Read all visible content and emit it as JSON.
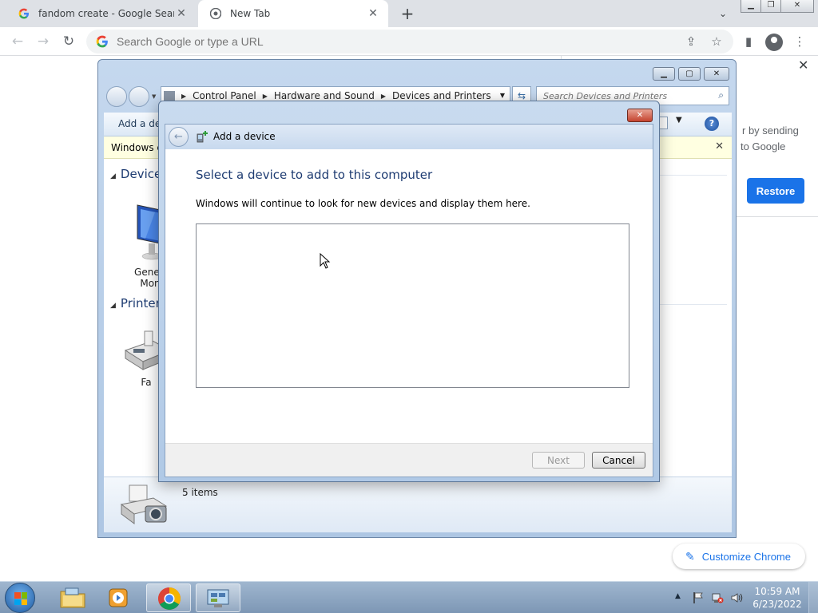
{
  "browser": {
    "tabs": [
      {
        "title": "fandom create - Google Search",
        "close": "✕"
      },
      {
        "title": "New Tab",
        "close": "✕"
      }
    ],
    "new_tab": "+",
    "omnibox_placeholder": "Search Google or type a URL",
    "side_panel": {
      "text_line1": "r by sending",
      "text_line2": "to Google",
      "restore_label": "Restore"
    },
    "customize_label": "Customize Chrome"
  },
  "explorer": {
    "breadcrumb": [
      "Control Panel",
      "Hardware and Sound",
      "Devices and Printers"
    ],
    "search_placeholder": "Search Devices and Printers",
    "command_add": "Add a dev",
    "infobar_text": "Windows ca",
    "groups": {
      "devices": "Devices",
      "printers": "Printers"
    },
    "device_label_line1": "Generi",
    "device_label_line2": "Mon",
    "printer_label": "Fa",
    "status_count": "5 items"
  },
  "dialog": {
    "title": "Add a device",
    "heading": "Select a device to add to this computer",
    "description": "Windows will continue to look for new devices and display them here.",
    "next_label": "Next",
    "cancel_label": "Cancel"
  },
  "taskbar": {
    "time": "10:59 AM",
    "date": "6/23/2022"
  },
  "colors": {
    "chrome_blue": "#1a73e8",
    "win7_title": "#1e3c72"
  }
}
